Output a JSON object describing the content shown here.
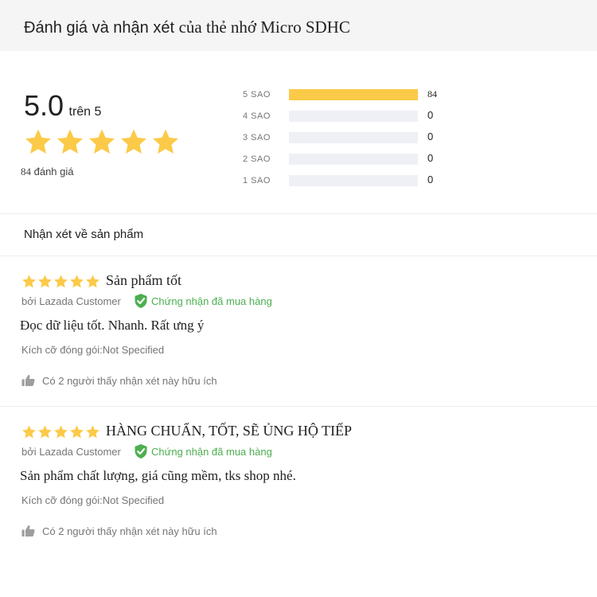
{
  "header": {
    "title_sans": "Đánh giá và nhận xét ",
    "title_serif": "của thẻ nhớ Micro SDHC"
  },
  "summary": {
    "average": "5.0",
    "out_of": "trên 5",
    "stars": 5,
    "review_count": "84",
    "review_count_label": " đánh giá",
    "star_color": "#fbca48",
    "empty_bar_color": "#eff0f5",
    "distribution": [
      {
        "label": "5 SAO",
        "count": "84",
        "fraction": 1.0
      },
      {
        "label": "4 SAO",
        "count": "0",
        "fraction": 0
      },
      {
        "label": "3 SAO",
        "count": "0",
        "fraction": 0
      },
      {
        "label": "2 SAO",
        "count": "0",
        "fraction": 0
      },
      {
        "label": "1 SAO",
        "count": "0",
        "fraction": 0
      }
    ]
  },
  "reviews_section": {
    "title": "Nhận xét về sản phẩm"
  },
  "reviews": [
    {
      "rating": 5,
      "title": "Sản phẩm tốt",
      "author": "bởi Lazada Customer",
      "verified_label": "Chứng nhận đã mua hàng",
      "verified_icon": "shield-check-icon",
      "content": "Đọc dữ liệu tốt. Nhanh. Rất ưng ý",
      "sku": "Kích cỡ đóng gói:Not Specified",
      "helpful": "Có 2 người thấy nhận xét này hữu ích",
      "helpful_icon": "thumbs-up-icon"
    },
    {
      "rating": 5,
      "title": "HÀNG CHUẨN, TỐT, SẼ ỦNG HỘ TIẾP",
      "author": "bởi Lazada Customer",
      "verified_label": "Chứng nhận đã mua hàng",
      "verified_icon": "shield-check-icon",
      "content": "Sản phẩm chất lượng, giá cũng mềm, tks shop nhé.",
      "sku": "Kích cỡ đóng gói:Not Specified",
      "helpful": "Có 2 người thấy nhận xét này hữu ích",
      "helpful_icon": "thumbs-up-icon"
    }
  ],
  "colors": {
    "verified_green": "#4caf50",
    "header_bg": "#f5f5f5"
  }
}
